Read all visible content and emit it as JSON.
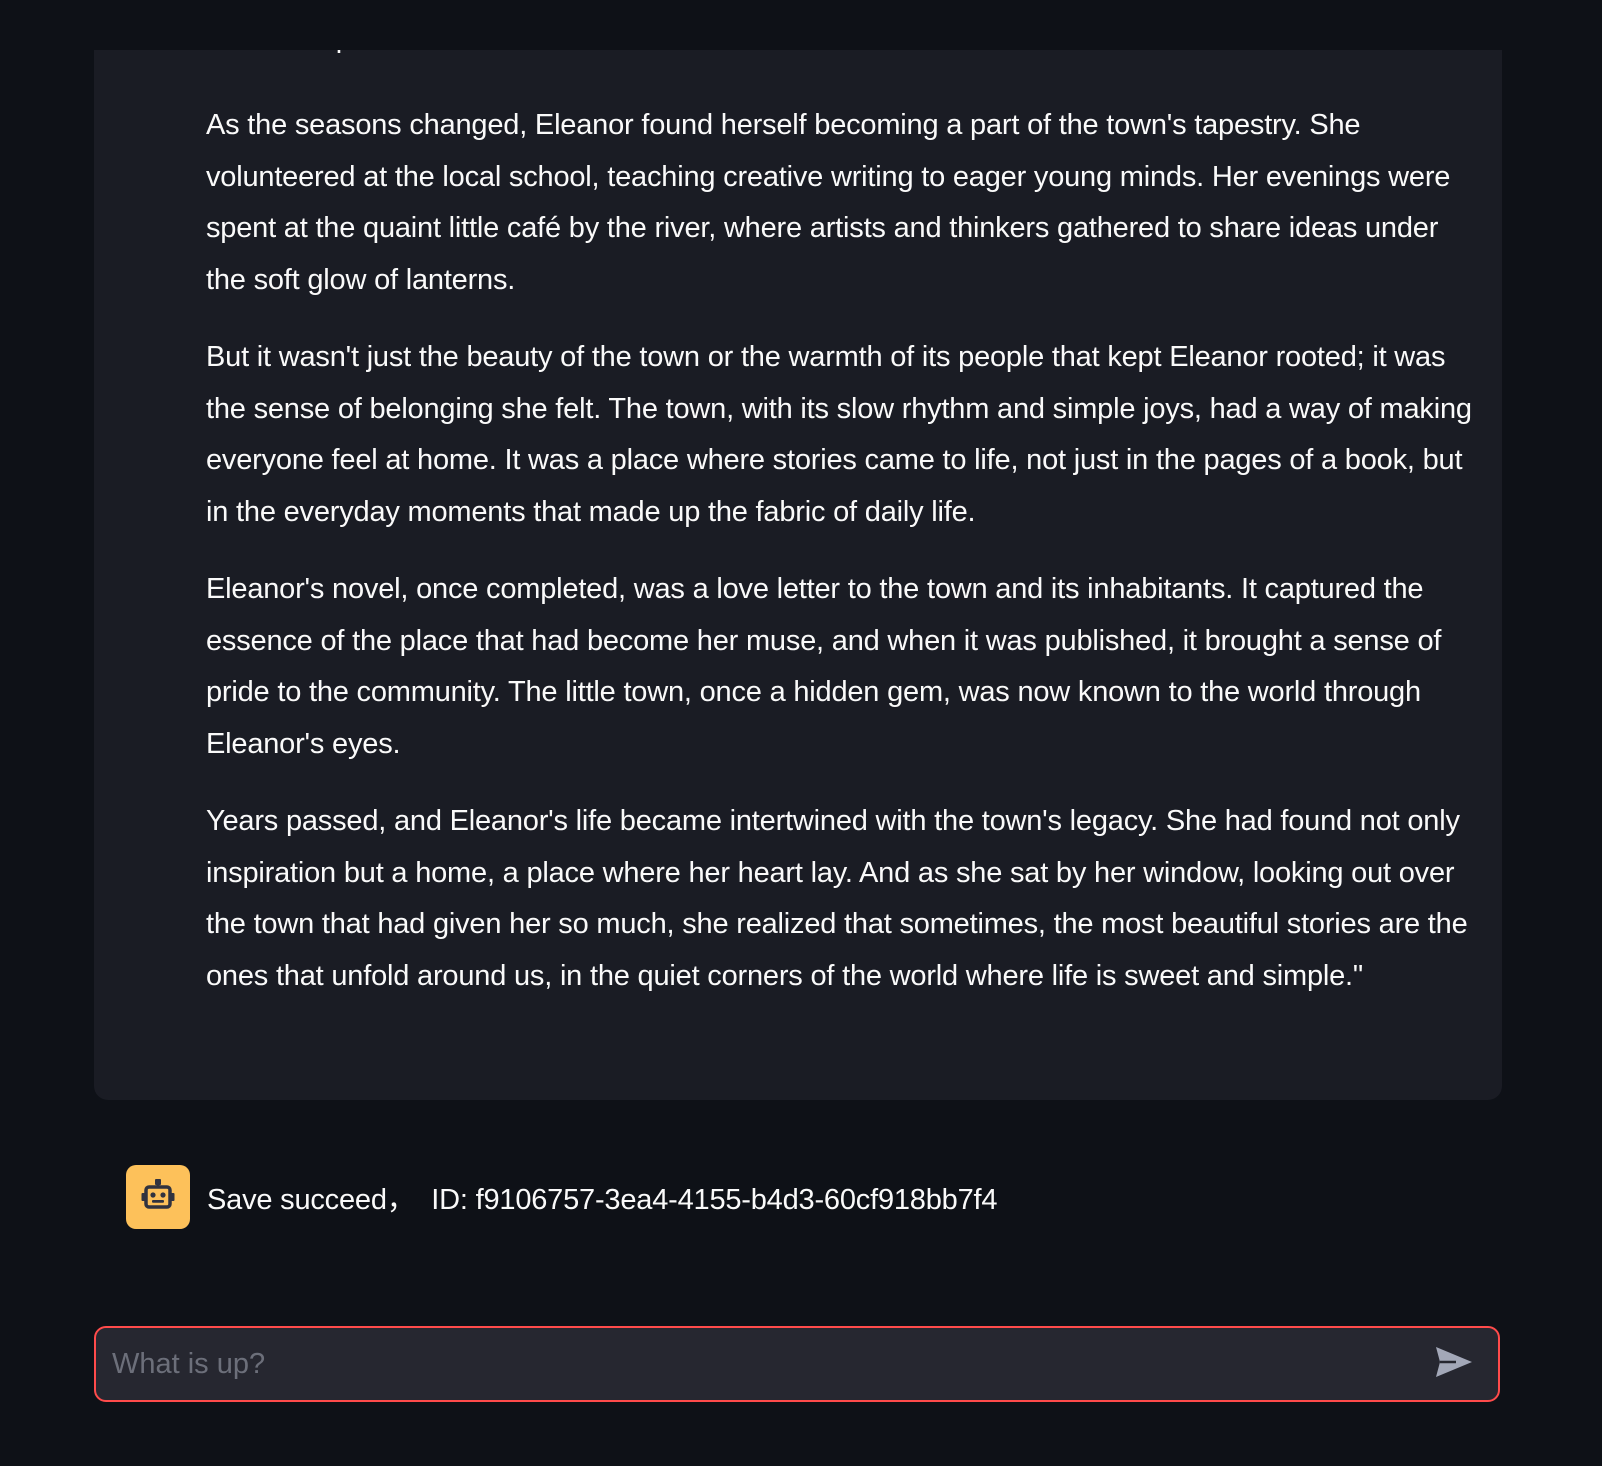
{
  "chat": {
    "assistant_message": {
      "cut_off_line": "its vibrant present.",
      "paragraphs": [
        "As the seasons changed, Eleanor found herself becoming a part of the town's tapestry. She volunteered at the local school, teaching creative writing to eager young minds. Her evenings were spent at the quaint little café by the river, where artists and thinkers gathered to share ideas under the soft glow of lanterns.",
        "But it wasn't just the beauty of the town or the warmth of its people that kept Eleanor rooted; it was the sense of belonging she felt. The town, with its slow rhythm and simple joys, had a way of making everyone feel at home. It was a place where stories came to life, not just in the pages of a book, but in the everyday moments that made up the fabric of daily life.",
        "Eleanor's novel, once completed, was a love letter to the town and its inhabitants. It captured the essence of the place that had become her muse, and when it was published, it brought a sense of pride to the community. The little town, once a hidden gem, was now known to the world through Eleanor's eyes.",
        "Years passed, and Eleanor's life became intertwined with the town's legacy. She had found not only inspiration but a home, a place where her heart lay. And as she sat by her window, looking out over the town that had given her so much, she realized that sometimes, the most beautiful stories are the ones that unfold around us, in the quiet corners of the world where life is sweet and simple.\""
      ]
    },
    "status_message": {
      "text": "Save succeed，  ID: f9106757-3ea4-4155-b4d3-60cf918bb7f4",
      "avatar_icon": "robot-icon",
      "avatar_color": "#fdc15a"
    },
    "input": {
      "placeholder": "What is up?",
      "value": "",
      "border_color": "#ff4b4b",
      "send_icon": "send-icon"
    }
  },
  "colors": {
    "background": "#0e1117",
    "message_background": "#1a1c24",
    "text": "#fafafa"
  }
}
